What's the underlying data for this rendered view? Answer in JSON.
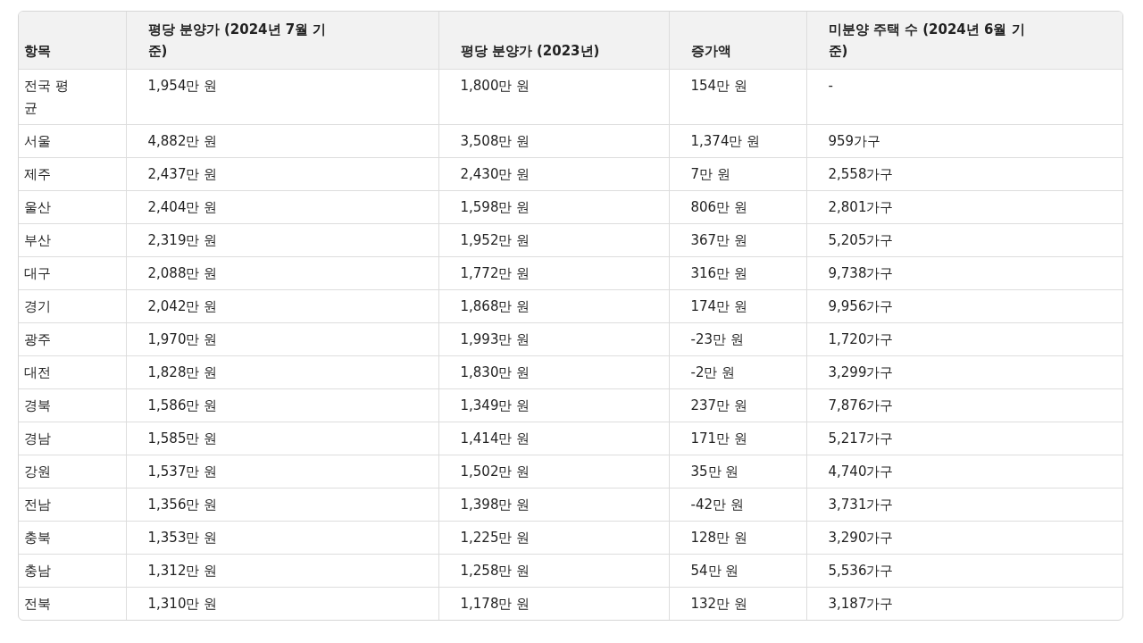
{
  "table": {
    "columns": [
      "항목",
      "평당 분양가 (2024년 7월 기준)",
      "평당 분양가 (2023년)",
      "증가액",
      "미분양 주택 수 (2024년 6월 기준)"
    ],
    "rows": [
      [
        "전국 평균",
        "1,954만 원",
        "1,800만 원",
        "154만 원",
        "-"
      ],
      [
        "서울",
        "4,882만 원",
        "3,508만 원",
        "1,374만 원",
        "959가구"
      ],
      [
        "제주",
        "2,437만 원",
        "2,430만 원",
        "7만 원",
        "2,558가구"
      ],
      [
        "울산",
        "2,404만 원",
        "1,598만 원",
        "806만 원",
        "2,801가구"
      ],
      [
        "부산",
        "2,319만 원",
        "1,952만 원",
        "367만 원",
        "5,205가구"
      ],
      [
        "대구",
        "2,088만 원",
        "1,772만 원",
        "316만 원",
        "9,738가구"
      ],
      [
        "경기",
        "2,042만 원",
        "1,868만 원",
        "174만 원",
        "9,956가구"
      ],
      [
        "광주",
        "1,970만 원",
        "1,993만 원",
        "-23만 원",
        "1,720가구"
      ],
      [
        "대전",
        "1,828만 원",
        "1,830만 원",
        "-2만 원",
        "3,299가구"
      ],
      [
        "경북",
        "1,586만 원",
        "1,349만 원",
        "237만 원",
        "7,876가구"
      ],
      [
        "경남",
        "1,585만 원",
        "1,414만 원",
        "171만 원",
        "5,217가구"
      ],
      [
        "강원",
        "1,537만 원",
        "1,502만 원",
        "35만 원",
        "4,740가구"
      ],
      [
        "전남",
        "1,356만 원",
        "1,398만 원",
        "-42만 원",
        "3,731가구"
      ],
      [
        "충북",
        "1,353만 원",
        "1,225만 원",
        "128만 원",
        "3,290가구"
      ],
      [
        "충남",
        "1,312만 원",
        "1,258만 원",
        "54만 원",
        "5,536가구"
      ],
      [
        "전북",
        "1,310만 원",
        "1,178만 원",
        "132만 원",
        "3,187가구"
      ]
    ]
  }
}
